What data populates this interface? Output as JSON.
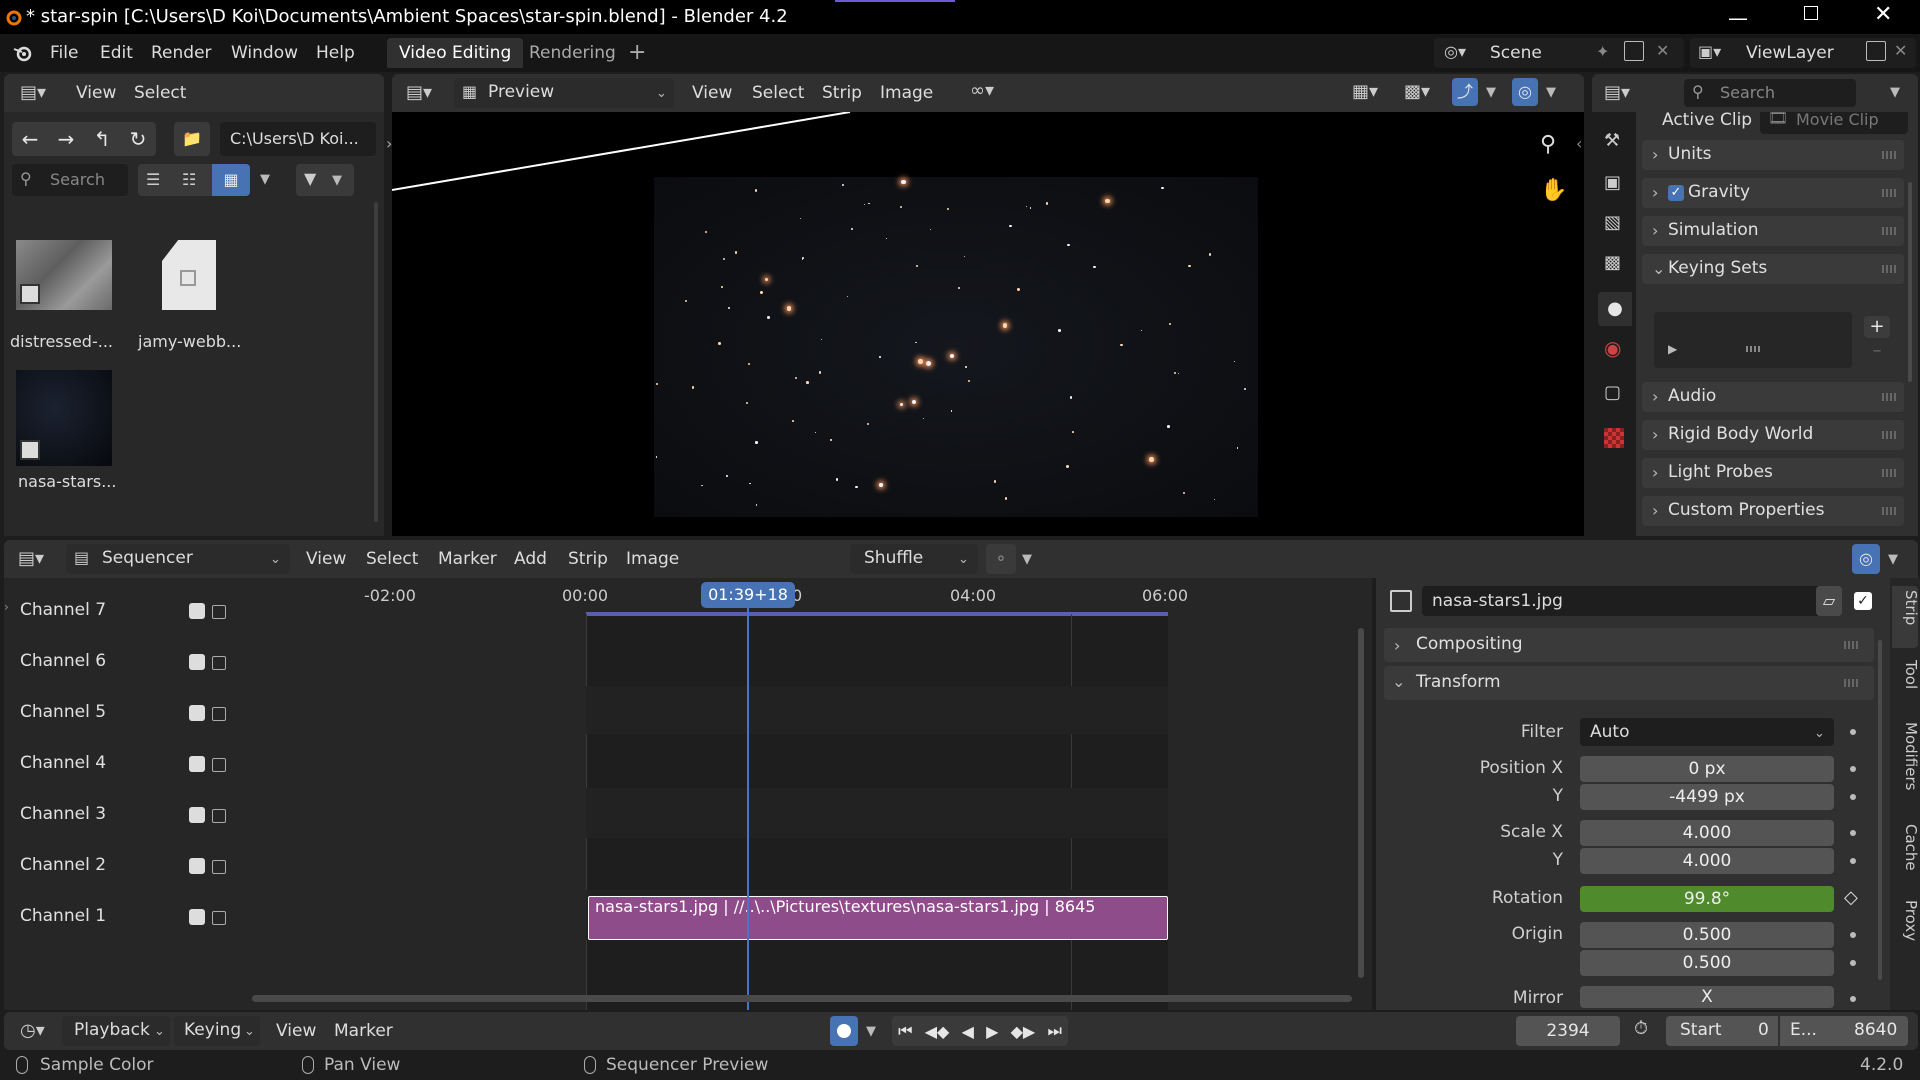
{
  "window": {
    "title": "* star-spin [C:\\Users\\D Koi\\Documents\\Ambient Spaces\\star-spin.blend] - Blender 4.2"
  },
  "menubar": {
    "items": [
      "File",
      "Edit",
      "Render",
      "Window",
      "Help"
    ],
    "workspace_tabs": [
      "Video Editing",
      "Rendering"
    ],
    "scene": "Scene",
    "view_layer": "ViewLayer"
  },
  "file_browser": {
    "header_menus": [
      "View",
      "Select"
    ],
    "path": "C:\\Users\\D Koi...",
    "search_placeholder": "Search",
    "files": [
      {
        "name": "distressed-...",
        "kind": "image"
      },
      {
        "name": "jamy-webb...",
        "kind": "file"
      },
      {
        "name": "nasa-stars...",
        "kind": "image"
      }
    ]
  },
  "preview": {
    "mode": "Preview",
    "menus": [
      "View",
      "Select",
      "Strip",
      "Image"
    ]
  },
  "properties": {
    "search_placeholder": "Search",
    "active_clip_label": "Active Clip",
    "movie_clip_placeholder": "Movie Clip",
    "panels": [
      {
        "label": "Units",
        "expanded": false
      },
      {
        "label": "Gravity",
        "expanded": false,
        "checkbox": true
      },
      {
        "label": "Simulation",
        "expanded": false
      },
      {
        "label": "Keying Sets",
        "expanded": true
      },
      {
        "label": "Audio",
        "expanded": false
      },
      {
        "label": "Rigid Body World",
        "expanded": false
      },
      {
        "label": "Light Probes",
        "expanded": false
      },
      {
        "label": "Custom Properties",
        "expanded": false
      }
    ]
  },
  "sequencer": {
    "editor": "Sequencer",
    "menus": [
      "View",
      "Select",
      "Marker",
      "Add",
      "Strip",
      "Image"
    ],
    "overlap_mode": "Shuffle",
    "time_labels": [
      "-02:00",
      "00:00",
      "04:00",
      "06:00"
    ],
    "playhead": "01:39+18",
    "playhead_tail": "0",
    "channels": [
      "Channel 7",
      "Channel 6",
      "Channel 5",
      "Channel 4",
      "Channel 3",
      "Channel 2",
      "Channel 1"
    ],
    "strip_label": "nasa-stars1.jpg | //..\\..\\Pictures\\textures\\nasa-stars1.jpg | 8645"
  },
  "strip_props": {
    "name": "nasa-stars1.jpg",
    "compositing_label": "Compositing",
    "transform_label": "Transform",
    "filter_label": "Filter",
    "filter_value": "Auto",
    "position_x_label": "Position X",
    "position_x": "0 px",
    "y_label": "Y",
    "position_y": "-4499 px",
    "scale_x_label": "Scale X",
    "scale_x": "4.000",
    "scale_y": "4.000",
    "rotation_label": "Rotation",
    "rotation": "99.8°",
    "origin_label": "Origin",
    "origin_x": "0.500",
    "origin_y": "0.500",
    "mirror_label": "Mirror",
    "mirror_x": "X",
    "side_tabs": [
      "Strip",
      "Tool",
      "Modifiers",
      "Cache",
      "Proxy"
    ]
  },
  "timeline": {
    "menus": [
      "Playback",
      "Keying",
      "View",
      "Marker"
    ],
    "current_frame": "2394",
    "start_label": "Start",
    "start": "0",
    "end_label": "E...",
    "end": "8640"
  },
  "statusbar": {
    "items": [
      "Sample Color",
      "Pan View",
      "Sequencer Preview"
    ],
    "version": "4.2.0"
  },
  "colors": {
    "accent": "#4772b3",
    "strip": "#8e4d8a",
    "rotation_field": "#4f8a2c"
  }
}
